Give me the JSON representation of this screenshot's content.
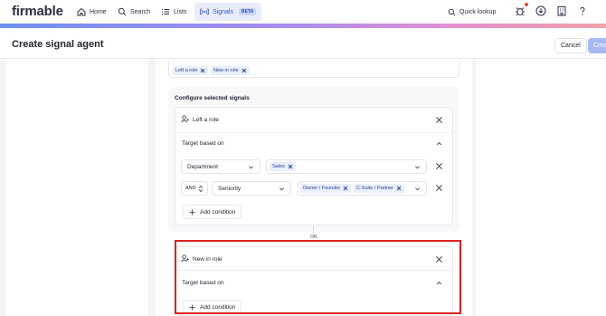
{
  "app": {
    "logo": "firmable",
    "nav": [
      {
        "label": "Home",
        "icon": "home-icon"
      },
      {
        "label": "Search",
        "icon": "search-icon"
      },
      {
        "label": "Lists",
        "icon": "list-icon"
      },
      {
        "label": "Signals",
        "icon": "signals-icon",
        "badge": "BETA",
        "active": true
      }
    ],
    "quick_lookup": "Quick lookup"
  },
  "header": {
    "title": "Create signal agent",
    "cancel_label": "Cancel",
    "create_label": "Crea"
  },
  "selected_signals": {
    "chips": [
      "Left a role",
      "New in role"
    ]
  },
  "config": {
    "title": "Configure selected signals",
    "or_label": "OR",
    "cards": [
      {
        "signal": "Left a role",
        "target_label": "Target based on",
        "rows": [
          {
            "field": "Department",
            "values": [
              "Sales"
            ]
          },
          {
            "operator": "AND",
            "field": "Seniority",
            "values": [
              "Owner / Founder",
              "C-Suite / Partner"
            ]
          }
        ],
        "add_condition_label": "Add condition"
      },
      {
        "signal": "New in role",
        "target_label": "Target based on",
        "add_condition_label": "Add condition"
      }
    ]
  },
  "colors": {
    "accent": "#3d4fd6",
    "highlight": "#e02020",
    "chip_bg": "#e9effc"
  }
}
